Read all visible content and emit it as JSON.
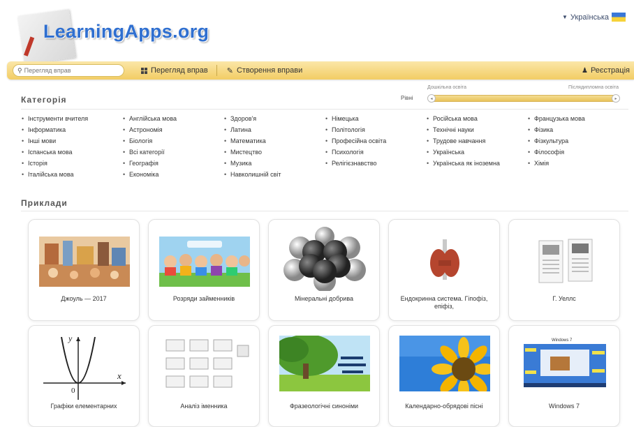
{
  "header": {
    "logo_text": "LearningApps.org",
    "language": "Українська"
  },
  "toolbar": {
    "search_placeholder": "Перегляд вправ",
    "browse_label": "Перегляд вправ",
    "create_label": "Створення вправи",
    "register_label": "Реєстрація"
  },
  "categories": {
    "title": "Категорія",
    "age_all_label": "Рівні",
    "age_left_label": "Дошкільна освіта",
    "age_right_label": "Післядипломна освіта",
    "columns": [
      [
        "Інструменти вчителя",
        "Інформатика",
        "Інші мови",
        "Іспанська мова",
        "Історія",
        "Італійська мова"
      ],
      [
        "Англійська мова",
        "Астрономія",
        "Біологія",
        "Всі категорії",
        "Географія",
        "Економіка"
      ],
      [
        "Здоров'я",
        "Латина",
        "Математика",
        "Мистецтво",
        "Музика",
        "Навколишній світ"
      ],
      [
        "Німецька",
        "Політологія",
        "Професійна освіта",
        "Психологія",
        "Релігієзнавство"
      ],
      [
        "Російська мова",
        "Технічні науки",
        "Трудове навчання",
        "Українська",
        "Українська як іноземна"
      ],
      [
        "Французька мова",
        "Фізика",
        "Фізкультура",
        "Філософія",
        "Хімія"
      ]
    ]
  },
  "examples": {
    "title": "Приклади",
    "cards": [
      {
        "caption": "Джоуль — 2017",
        "image": "illustration-thumb"
      },
      {
        "caption": "Розряди займенників",
        "image": "children-banner-thumb"
      },
      {
        "caption": "Мінеральні добрива",
        "image": "molecule-thumb"
      },
      {
        "caption": "Ендокринна система. Гіпофіз, епіфіз,",
        "image": "thyroid-thumb"
      },
      {
        "caption": "Г. Уеллс",
        "image": "worksheet-thumb"
      },
      {
        "caption": "Графіки елементарних",
        "image": "parabola-graph-thumb"
      },
      {
        "caption": "Аналіз іменника",
        "image": "cards-thumb"
      },
      {
        "caption": "Фразеологічні синоніми",
        "image": "tree-landscape-thumb"
      },
      {
        "caption": "Календарно-обрядові пісні",
        "image": "sunflower-thumb"
      },
      {
        "caption": "Windows 7",
        "image": "windows-screen-thumb"
      }
    ],
    "graph_labels": {
      "y": "y",
      "x": "x",
      "origin": "0"
    },
    "windows_thumb_title": "Windows 7"
  },
  "colors": {
    "accent_bar": "#f2cd64",
    "logo_blue": "#2f6fd0"
  }
}
